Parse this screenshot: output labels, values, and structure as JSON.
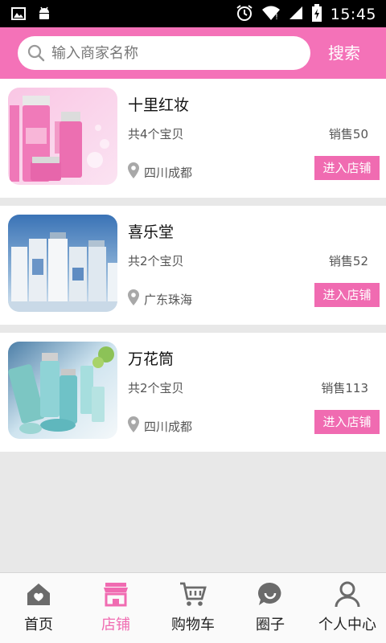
{
  "status_bar": {
    "time": "15:45"
  },
  "search": {
    "placeholder": "输入商家名称",
    "button_label": "搜索"
  },
  "colors": {
    "brand": "#f472b8",
    "accent": "#f06bb1",
    "background": "#e8e8e8"
  },
  "stores": [
    {
      "name": "十里红妆",
      "count": "共4个宝贝",
      "sales": "销售50",
      "location": "四川成都",
      "enter_label": "进入店铺",
      "image": "pink-cosmetics-image"
    },
    {
      "name": "喜乐堂",
      "count": "共2个宝贝",
      "sales": "销售52",
      "location": "广东珠海",
      "enter_label": "进入店铺",
      "image": "blue-skincare-image"
    },
    {
      "name": "万花筒",
      "count": "共2个宝贝",
      "sales": "销售113",
      "location": "四川成都",
      "enter_label": "进入店铺",
      "image": "teal-skincare-image"
    }
  ],
  "nav": [
    {
      "label": "首页",
      "icon": "home-icon",
      "active": false
    },
    {
      "label": "店铺",
      "icon": "store-icon",
      "active": true
    },
    {
      "label": "购物车",
      "icon": "cart-icon",
      "active": false
    },
    {
      "label": "圈子",
      "icon": "chat-icon",
      "active": false
    },
    {
      "label": "个人中心",
      "icon": "user-icon",
      "active": false
    }
  ]
}
